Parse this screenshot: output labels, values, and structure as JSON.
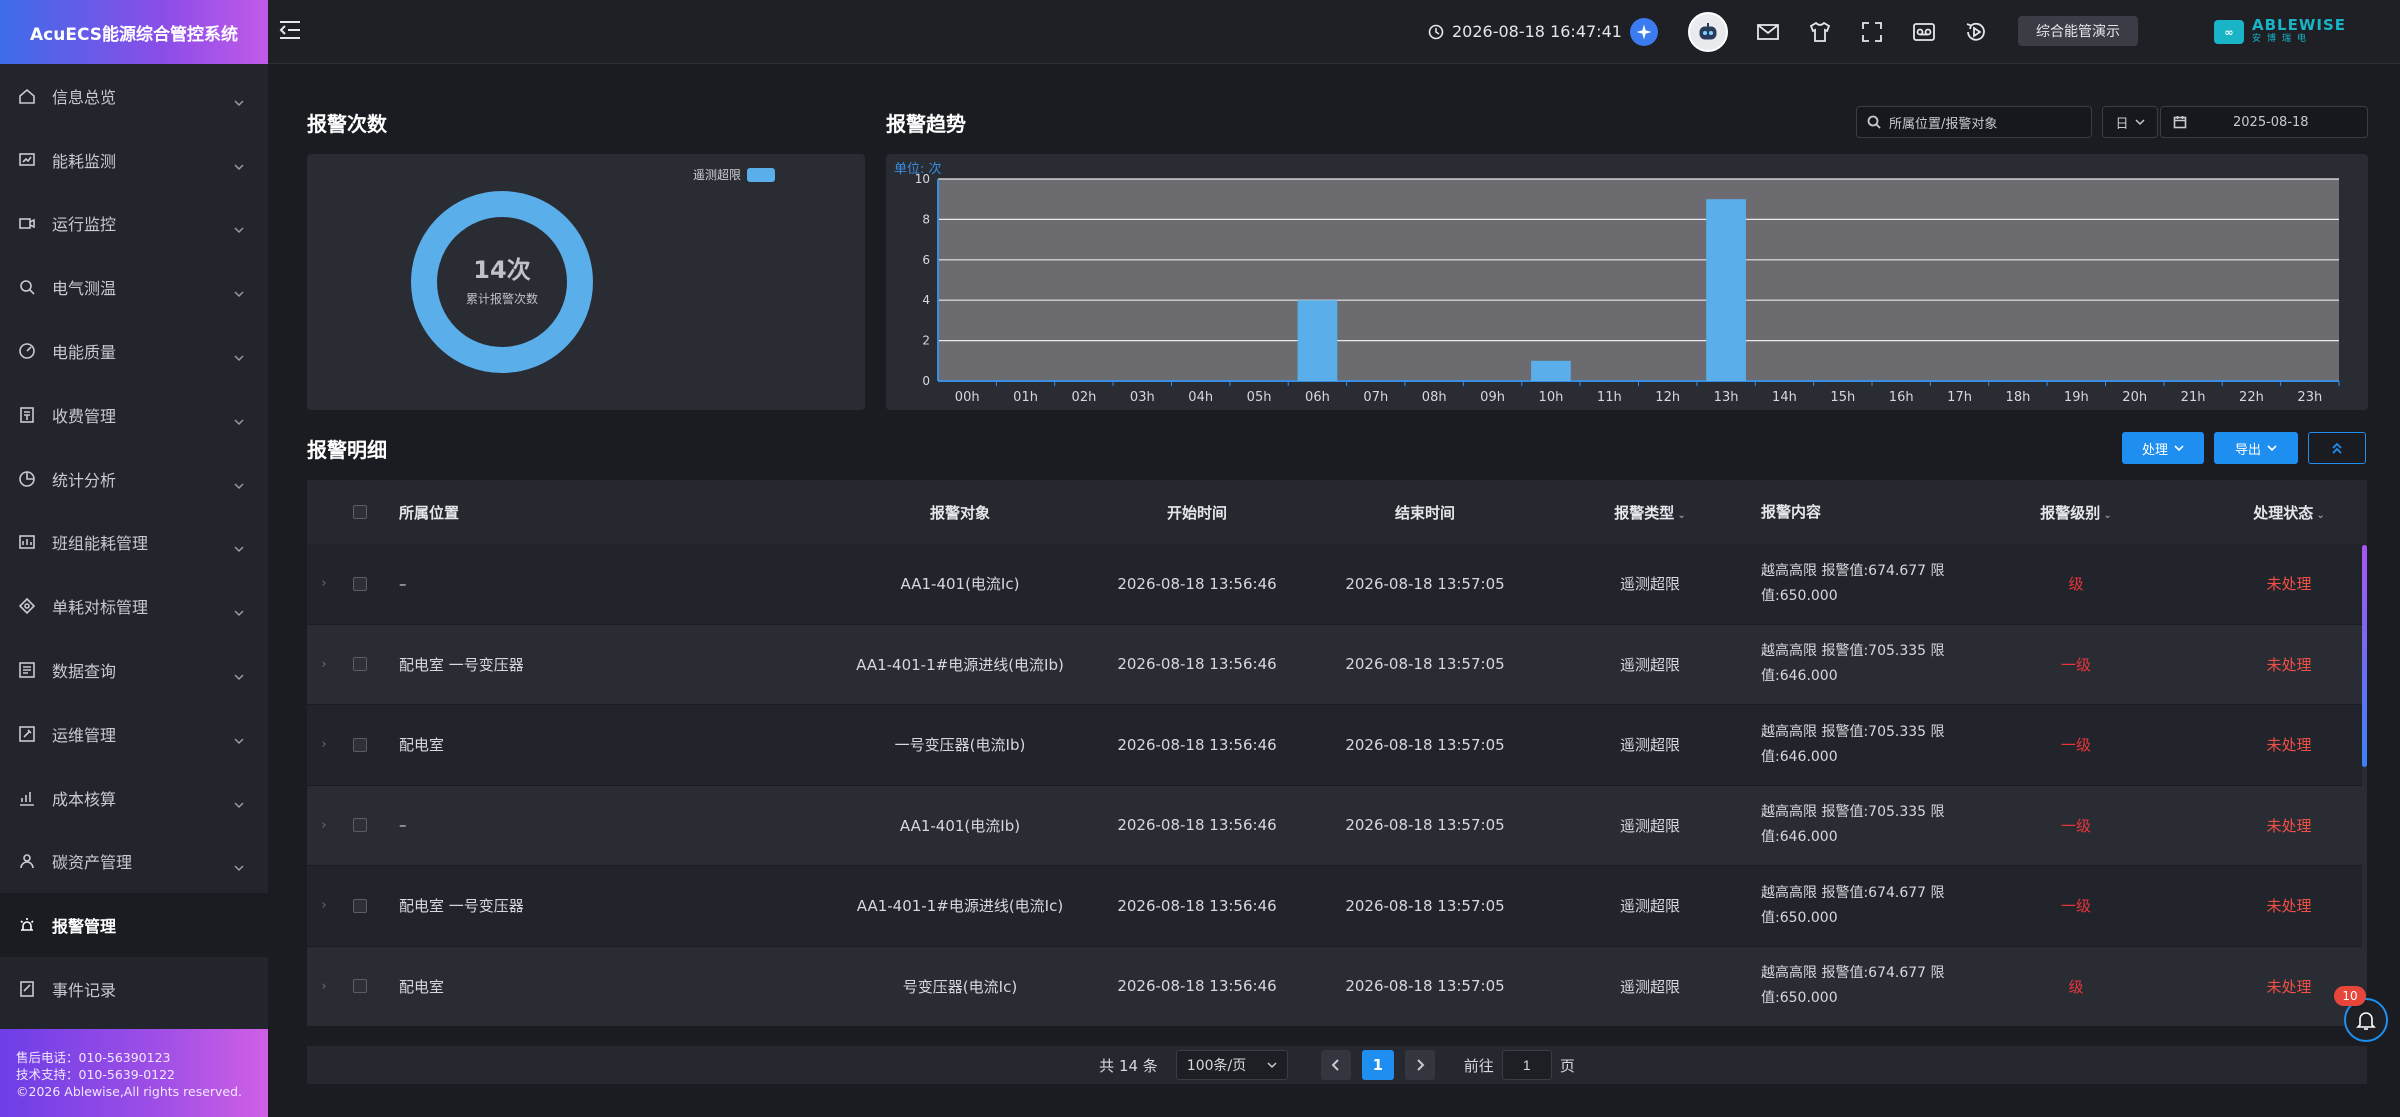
{
  "app": {
    "title": "AcuECS能源综合管控系统"
  },
  "sidebar": {
    "items": [
      {
        "label": "信息总览",
        "icon": "home-icon"
      },
      {
        "label": "能耗监测",
        "icon": "monitor-chart-icon"
      },
      {
        "label": "运行监控",
        "icon": "camera-icon"
      },
      {
        "label": "电气测温",
        "icon": "thermo-search-icon"
      },
      {
        "label": "电能质量",
        "icon": "gauge-icon"
      },
      {
        "label": "收费管理",
        "icon": "billing-icon"
      },
      {
        "label": "统计分析",
        "icon": "pie-icon"
      },
      {
        "label": "班组能耗管理",
        "icon": "team-energy-icon"
      },
      {
        "label": "单耗对标管理",
        "icon": "benchmark-icon"
      },
      {
        "label": "数据查询",
        "icon": "data-query-icon"
      },
      {
        "label": "运维管理",
        "icon": "maintenance-icon"
      },
      {
        "label": "成本核算",
        "icon": "cost-chart-icon"
      },
      {
        "label": "碳资产管理",
        "icon": "carbon-icon"
      },
      {
        "label": "报警管理",
        "icon": "alarm-icon",
        "active": true
      },
      {
        "label": "事件记录",
        "icon": "event-record-icon"
      }
    ],
    "footer": {
      "line1": "售后电话：010-56390123",
      "line2": "技术支持：010-5639-0122",
      "line3": "©2026 Ablewise,All rights reserved."
    }
  },
  "header": {
    "datetime": "2026-08-18 16:47:41",
    "demo_button": "综合能管演示",
    "logo_text": "ABLEWISE",
    "logo_sub": "安博瑞电"
  },
  "alarm_count": {
    "title": "报警次数",
    "legend": "遥测超限",
    "value": "14次",
    "label": "累计报警次数",
    "total": 14,
    "color": "#5aaeea"
  },
  "trend": {
    "title": "报警趋势",
    "search_placeholder": "所属位置/报警对象",
    "period": "日",
    "date": "2025-08-18"
  },
  "chart_data": {
    "type": "bar",
    "title": "",
    "unit_label": "单位: 次",
    "categories": [
      "00h",
      "01h",
      "02h",
      "03h",
      "04h",
      "05h",
      "06h",
      "07h",
      "08h",
      "09h",
      "10h",
      "11h",
      "12h",
      "13h",
      "14h",
      "15h",
      "16h",
      "17h",
      "18h",
      "19h",
      "20h",
      "21h",
      "22h",
      "23h"
    ],
    "values": [
      0,
      0,
      0,
      0,
      0,
      0,
      4,
      0,
      0,
      0,
      1,
      0,
      0,
      9,
      0,
      0,
      0,
      0,
      0,
      0,
      0,
      0,
      0,
      0
    ],
    "ylim": [
      0,
      10
    ],
    "yticks": [
      0,
      2,
      4,
      6,
      8,
      10
    ],
    "grid": true,
    "colors": {
      "bar": "#5aaeea",
      "plot_bg": "#6b6b70",
      "axis": "#3a8ee0"
    }
  },
  "detail": {
    "title": "报警明细",
    "btn_process": "处理",
    "btn_export": "导出",
    "columns": [
      "所属位置",
      "报警对象",
      "开始时间",
      "结束时间",
      "报警类型",
      "报警内容",
      "报警级别",
      "处理状态"
    ],
    "rows": [
      {
        "location": "–",
        "object": "AA1-401(电流Ic)",
        "start": "2026-08-18 13:56:46",
        "end": "2026-08-18 13:57:05",
        "type": "遥测超限",
        "content": "越高高限 报警值:674.677 限值:650.000",
        "level": "级",
        "status": "未处理"
      },
      {
        "location": "配电室 一号变压器",
        "object": "AA1-401-1#电源进线(电流Ib)",
        "start": "2026-08-18 13:56:46",
        "end": "2026-08-18 13:57:05",
        "type": "遥测超限",
        "content": "越高高限 报警值:705.335 限值:646.000",
        "level": "一级",
        "status": "未处理"
      },
      {
        "location": "配电室",
        "object": "一号变压器(电流Ib)",
        "start": "2026-08-18 13:56:46",
        "end": "2026-08-18 13:57:05",
        "type": "遥测超限",
        "content": "越高高限 报警值:705.335 限值:646.000",
        "level": "一级",
        "status": "未处理"
      },
      {
        "location": "–",
        "object": "AA1-401(电流Ib)",
        "start": "2026-08-18 13:56:46",
        "end": "2026-08-18 13:57:05",
        "type": "遥测超限",
        "content": "越高高限 报警值:705.335 限值:646.000",
        "level": "一级",
        "status": "未处理"
      },
      {
        "location": "配电室 一号变压器",
        "object": "AA1-401-1#电源进线(电流Ic)",
        "start": "2026-08-18 13:56:46",
        "end": "2026-08-18 13:57:05",
        "type": "遥测超限",
        "content": "越高高限 报警值:674.677 限值:650.000",
        "level": "一级",
        "status": "未处理"
      },
      {
        "location": "配电室",
        "object": "号变压器(电流Ic)",
        "start": "2026-08-18 13:56:46",
        "end": "2026-08-18 13:57:05",
        "type": "遥测超限",
        "content": "越高高限 报警值:674.677 限值:650.000",
        "level": "级",
        "status": "未处理"
      }
    ]
  },
  "pagination": {
    "total": "共 14 条",
    "page_size": "100条/页",
    "current": "1",
    "goto_label": "前往",
    "goto_value": "1",
    "page_suffix": "页"
  },
  "notifications": {
    "badge": "10"
  }
}
